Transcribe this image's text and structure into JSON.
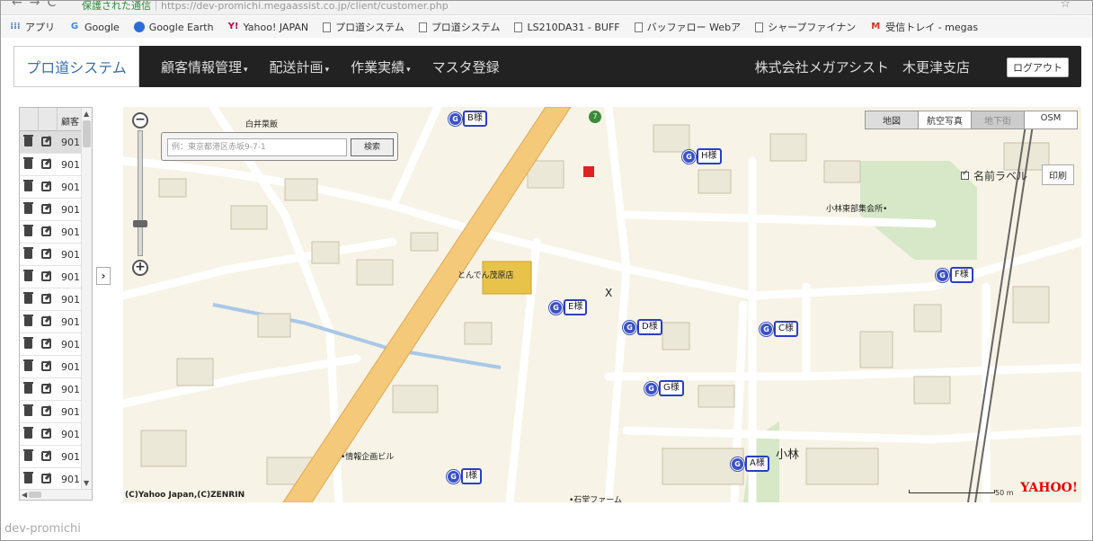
{
  "browser": {
    "url_secure": "保護された通信",
    "url": "https://dev-promichi.megaassist.co.jp/client/customer.php",
    "bookmarks": [
      {
        "label": "アプリ",
        "icon": "apps-icon"
      },
      {
        "label": "Google",
        "icon": "google-icon"
      },
      {
        "label": "Google Earth",
        "icon": "google-earth-icon"
      },
      {
        "label": "Yahoo! JAPAN",
        "icon": "yahoo-icon"
      },
      {
        "label": "プロ道システム",
        "icon": "page-icon"
      },
      {
        "label": "プロ道システム",
        "icon": "page-icon"
      },
      {
        "label": "LS210DA31 - BUFF",
        "icon": "page-icon"
      },
      {
        "label": "バッファロー Webア",
        "icon": "page-icon"
      },
      {
        "label": "シャープファイナン",
        "icon": "page-icon"
      },
      {
        "label": "受信トレイ - megas",
        "icon": "gmail-icon"
      }
    ]
  },
  "navbar": {
    "brand": "プロ道システム",
    "menu": [
      {
        "label": "顧客情報管理",
        "caret": "▾"
      },
      {
        "label": "配送計画",
        "caret": "▾"
      },
      {
        "label": "作業実績",
        "caret": "▾"
      },
      {
        "label": "マスタ登録",
        "caret": ""
      }
    ],
    "company": "株式会社メガアシスト　木更津支店",
    "logout": "ログアウト"
  },
  "customer_list": {
    "header": "顧客",
    "rows": [
      "901",
      "901",
      "901",
      "901",
      "901",
      "901",
      "901",
      "901",
      "901",
      "901",
      "901",
      "901",
      "901",
      "901",
      "901",
      "901"
    ],
    "last_row_suffix": "901"
  },
  "map": {
    "search_placeholder": "例：東京都港区赤坂9-7-1",
    "search_button": "検索",
    "layers": [
      {
        "label": "地図",
        "state": "active"
      },
      {
        "label": "航空写真",
        "state": "normal"
      },
      {
        "label": "地下街",
        "state": "dim"
      },
      {
        "label": "OSM",
        "state": "normal"
      }
    ],
    "name_label_toggle": "名前ラベル",
    "print_button": "印刷",
    "copyright": "(C)Yahoo Japan,(C)ZENRIN",
    "scale": "50 m",
    "logo": "YAHOO!",
    "pois": [
      {
        "label": "白井菜飯"
      },
      {
        "label": "とんでん茂原店"
      },
      {
        "label": "小林東部集会所•"
      },
      {
        "label": "•情報企画ビル"
      },
      {
        "label": "小林"
      },
      {
        "label": "•石堂ファーム"
      }
    ],
    "markers": [
      {
        "g": "G",
        "label": "B様"
      },
      {
        "g": "G",
        "label": "H様"
      },
      {
        "g": "G",
        "label": "F様"
      },
      {
        "g": "G",
        "label": "E様"
      },
      {
        "g": "G",
        "label": "D様"
      },
      {
        "g": "G",
        "label": "C様"
      },
      {
        "g": "G",
        "label": "G様"
      },
      {
        "g": "G",
        "label": "A様"
      },
      {
        "g": "G",
        "label": "I様"
      }
    ]
  },
  "footer": "dev-promichi"
}
